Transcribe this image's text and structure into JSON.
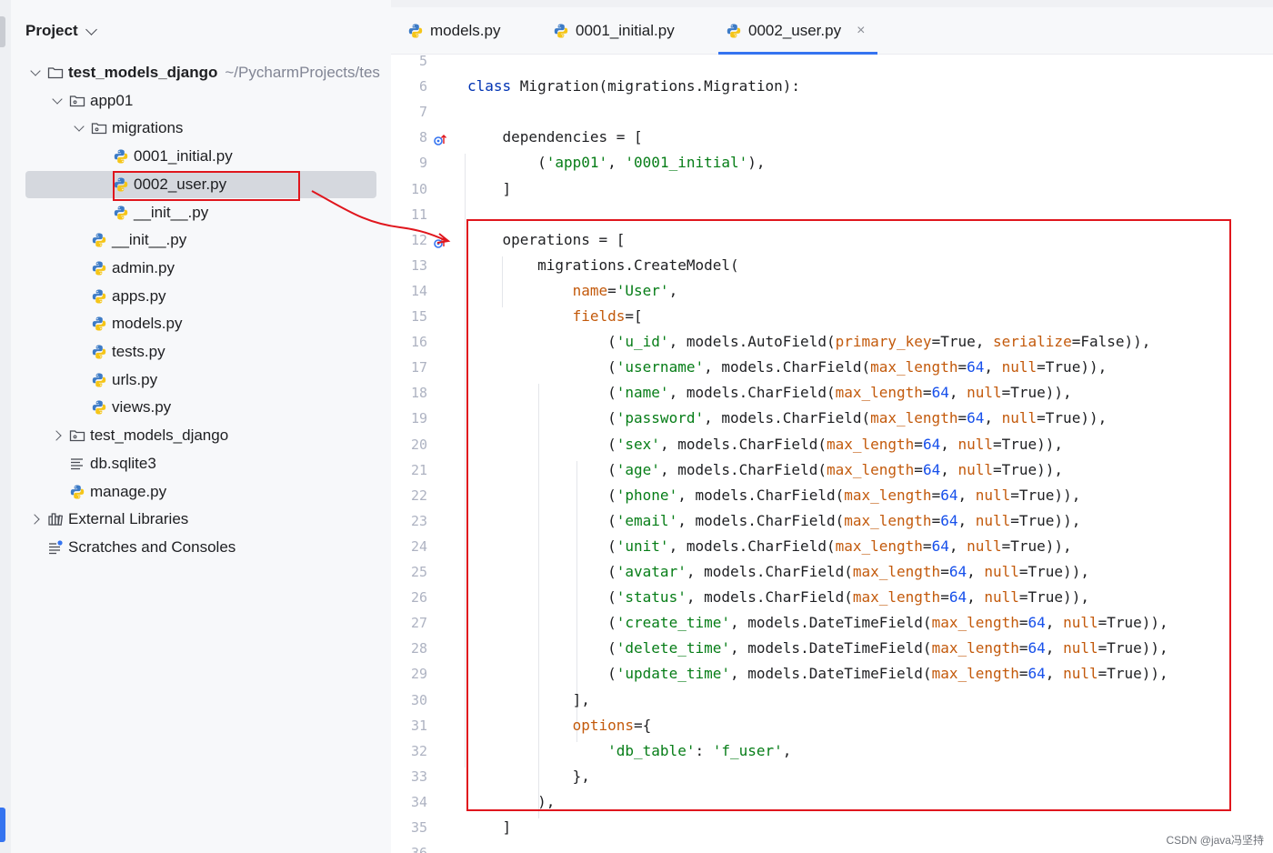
{
  "project_panel": {
    "title": "Project",
    "tree": [
      {
        "label": "test_models_django",
        "secondary": "~/PycharmProjects/tes",
        "icon": "folder-icon",
        "arrow": "down",
        "depth": 0,
        "bold": true
      },
      {
        "label": "app01",
        "icon": "package-folder-icon",
        "arrow": "down",
        "depth": 1
      },
      {
        "label": "migrations",
        "icon": "package-folder-icon",
        "arrow": "down",
        "depth": 2
      },
      {
        "label": "0001_initial.py",
        "icon": "python-file-icon",
        "arrow": "none",
        "depth": 3
      },
      {
        "label": "0002_user.py",
        "icon": "python-file-icon",
        "arrow": "none",
        "depth": 3,
        "selected": true
      },
      {
        "label": "__init__.py",
        "icon": "python-file-icon",
        "arrow": "none",
        "depth": 3
      },
      {
        "label": "__init__.py",
        "icon": "python-file-icon",
        "arrow": "none",
        "depth": 2
      },
      {
        "label": "admin.py",
        "icon": "python-file-icon",
        "arrow": "none",
        "depth": 2
      },
      {
        "label": "apps.py",
        "icon": "python-file-icon",
        "arrow": "none",
        "depth": 2
      },
      {
        "label": "models.py",
        "icon": "python-file-icon",
        "arrow": "none",
        "depth": 2
      },
      {
        "label": "tests.py",
        "icon": "python-file-icon",
        "arrow": "none",
        "depth": 2
      },
      {
        "label": "urls.py",
        "icon": "python-file-icon",
        "arrow": "none",
        "depth": 2
      },
      {
        "label": "views.py",
        "icon": "python-file-icon",
        "arrow": "none",
        "depth": 2
      },
      {
        "label": "test_models_django",
        "icon": "package-folder-icon",
        "arrow": "right",
        "depth": 1
      },
      {
        "label": "db.sqlite3",
        "icon": "text-file-icon",
        "arrow": "none",
        "depth": 1
      },
      {
        "label": "manage.py",
        "icon": "python-file-icon",
        "arrow": "none",
        "depth": 1
      },
      {
        "label": "External Libraries",
        "icon": "library-icon",
        "arrow": "right",
        "depth": 0
      },
      {
        "label": "Scratches and Consoles",
        "icon": "scratches-icon",
        "arrow": "none",
        "depth": 0
      }
    ]
  },
  "editor": {
    "tabs": [
      {
        "label": "models.py",
        "active": false
      },
      {
        "label": "0001_initial.py",
        "active": false
      },
      {
        "label": "0002_user.py",
        "active": true,
        "close": "×"
      }
    ],
    "lines": [
      {
        "n": "5",
        "tokens": []
      },
      {
        "n": "6",
        "tokens": [
          [
            "kw",
            "class "
          ],
          [
            "t",
            "Migration(migrations.Migration):"
          ]
        ]
      },
      {
        "n": "7",
        "tokens": []
      },
      {
        "n": "8",
        "gutter_icon": true,
        "tokens": [
          [
            "t",
            "    dependencies = ["
          ]
        ]
      },
      {
        "n": "9",
        "tokens": [
          [
            "t",
            "        ("
          ],
          [
            "str",
            "'app01'"
          ],
          [
            "t",
            ", "
          ],
          [
            "str",
            "'0001_initial'"
          ],
          [
            "t",
            "),"
          ]
        ]
      },
      {
        "n": "10",
        "tokens": [
          [
            "t",
            "    ]"
          ]
        ]
      },
      {
        "n": "11",
        "tokens": []
      },
      {
        "n": "12",
        "gutter_icon": true,
        "tokens": [
          [
            "t",
            "    operations = ["
          ]
        ]
      },
      {
        "n": "13",
        "tokens": [
          [
            "t",
            "        migrations.CreateModel("
          ]
        ]
      },
      {
        "n": "14",
        "tokens": [
          [
            "t",
            "            "
          ],
          [
            "or",
            "name"
          ],
          [
            "t",
            "="
          ],
          [
            "str",
            "'User'"
          ],
          [
            "t",
            ","
          ]
        ]
      },
      {
        "n": "15",
        "tokens": [
          [
            "t",
            "            "
          ],
          [
            "or",
            "fields"
          ],
          [
            "t",
            "=["
          ]
        ]
      },
      {
        "n": "16",
        "tokens": [
          [
            "t",
            "                ("
          ],
          [
            "str",
            "'u_id'"
          ],
          [
            "t",
            ", models.AutoField("
          ],
          [
            "or",
            "primary_key"
          ],
          [
            "t",
            "=True, "
          ],
          [
            "or",
            "serialize"
          ],
          [
            "t",
            "=False)),"
          ]
        ]
      },
      {
        "n": "17",
        "tokens": [
          [
            "t",
            "                ("
          ],
          [
            "str",
            "'username'"
          ],
          [
            "t",
            ", models.CharField("
          ],
          [
            "or",
            "max_length"
          ],
          [
            "t",
            "="
          ],
          [
            "num",
            "64"
          ],
          [
            "t",
            ", "
          ],
          [
            "or",
            "null"
          ],
          [
            "t",
            "=True)),"
          ]
        ]
      },
      {
        "n": "18",
        "tokens": [
          [
            "t",
            "                ("
          ],
          [
            "str",
            "'name'"
          ],
          [
            "t",
            ", models.CharField("
          ],
          [
            "or",
            "max_length"
          ],
          [
            "t",
            "="
          ],
          [
            "num",
            "64"
          ],
          [
            "t",
            ", "
          ],
          [
            "or",
            "null"
          ],
          [
            "t",
            "=True)),"
          ]
        ]
      },
      {
        "n": "19",
        "tokens": [
          [
            "t",
            "                ("
          ],
          [
            "str",
            "'password'"
          ],
          [
            "t",
            ", models.CharField("
          ],
          [
            "or",
            "max_length"
          ],
          [
            "t",
            "="
          ],
          [
            "num",
            "64"
          ],
          [
            "t",
            ", "
          ],
          [
            "or",
            "null"
          ],
          [
            "t",
            "=True)),"
          ]
        ]
      },
      {
        "n": "20",
        "tokens": [
          [
            "t",
            "                ("
          ],
          [
            "str",
            "'sex'"
          ],
          [
            "t",
            ", models.CharField("
          ],
          [
            "or",
            "max_length"
          ],
          [
            "t",
            "="
          ],
          [
            "num",
            "64"
          ],
          [
            "t",
            ", "
          ],
          [
            "or",
            "null"
          ],
          [
            "t",
            "=True)),"
          ]
        ]
      },
      {
        "n": "21",
        "tokens": [
          [
            "t",
            "                ("
          ],
          [
            "str",
            "'age'"
          ],
          [
            "t",
            ", models.CharField("
          ],
          [
            "or",
            "max_length"
          ],
          [
            "t",
            "="
          ],
          [
            "num",
            "64"
          ],
          [
            "t",
            ", "
          ],
          [
            "or",
            "null"
          ],
          [
            "t",
            "=True)),"
          ]
        ]
      },
      {
        "n": "22",
        "tokens": [
          [
            "t",
            "                ("
          ],
          [
            "str",
            "'phone'"
          ],
          [
            "t",
            ", models.CharField("
          ],
          [
            "or",
            "max_length"
          ],
          [
            "t",
            "="
          ],
          [
            "num",
            "64"
          ],
          [
            "t",
            ", "
          ],
          [
            "or",
            "null"
          ],
          [
            "t",
            "=True)),"
          ]
        ]
      },
      {
        "n": "23",
        "tokens": [
          [
            "t",
            "                ("
          ],
          [
            "str",
            "'email'"
          ],
          [
            "t",
            ", models.CharField("
          ],
          [
            "or",
            "max_length"
          ],
          [
            "t",
            "="
          ],
          [
            "num",
            "64"
          ],
          [
            "t",
            ", "
          ],
          [
            "or",
            "null"
          ],
          [
            "t",
            "=True)),"
          ]
        ]
      },
      {
        "n": "24",
        "tokens": [
          [
            "t",
            "                ("
          ],
          [
            "str",
            "'unit'"
          ],
          [
            "t",
            ", models.CharField("
          ],
          [
            "or",
            "max_length"
          ],
          [
            "t",
            "="
          ],
          [
            "num",
            "64"
          ],
          [
            "t",
            ", "
          ],
          [
            "or",
            "null"
          ],
          [
            "t",
            "=True)),"
          ]
        ]
      },
      {
        "n": "25",
        "tokens": [
          [
            "t",
            "                ("
          ],
          [
            "str",
            "'avatar'"
          ],
          [
            "t",
            ", models.CharField("
          ],
          [
            "or",
            "max_length"
          ],
          [
            "t",
            "="
          ],
          [
            "num",
            "64"
          ],
          [
            "t",
            ", "
          ],
          [
            "or",
            "null"
          ],
          [
            "t",
            "=True)),"
          ]
        ]
      },
      {
        "n": "26",
        "tokens": [
          [
            "t",
            "                ("
          ],
          [
            "str",
            "'status'"
          ],
          [
            "t",
            ", models.CharField("
          ],
          [
            "or",
            "max_length"
          ],
          [
            "t",
            "="
          ],
          [
            "num",
            "64"
          ],
          [
            "t",
            ", "
          ],
          [
            "or",
            "null"
          ],
          [
            "t",
            "=True)),"
          ]
        ]
      },
      {
        "n": "27",
        "tokens": [
          [
            "t",
            "                ("
          ],
          [
            "str",
            "'create_time'"
          ],
          [
            "t",
            ", models.DateTimeField("
          ],
          [
            "or",
            "max_length"
          ],
          [
            "t",
            "="
          ],
          [
            "num",
            "64"
          ],
          [
            "t",
            ", "
          ],
          [
            "or",
            "null"
          ],
          [
            "t",
            "=True)),"
          ]
        ]
      },
      {
        "n": "28",
        "tokens": [
          [
            "t",
            "                ("
          ],
          [
            "str",
            "'delete_time'"
          ],
          [
            "t",
            ", models.DateTimeField("
          ],
          [
            "or",
            "max_length"
          ],
          [
            "t",
            "="
          ],
          [
            "num",
            "64"
          ],
          [
            "t",
            ", "
          ],
          [
            "or",
            "null"
          ],
          [
            "t",
            "=True)),"
          ]
        ]
      },
      {
        "n": "29",
        "tokens": [
          [
            "t",
            "                ("
          ],
          [
            "str",
            "'update_time'"
          ],
          [
            "t",
            ", models.DateTimeField("
          ],
          [
            "or",
            "max_length"
          ],
          [
            "t",
            "="
          ],
          [
            "num",
            "64"
          ],
          [
            "t",
            ", "
          ],
          [
            "or",
            "null"
          ],
          [
            "t",
            "=True)),"
          ]
        ]
      },
      {
        "n": "30",
        "tokens": [
          [
            "t",
            "            ],"
          ]
        ]
      },
      {
        "n": "31",
        "tokens": [
          [
            "t",
            "            "
          ],
          [
            "or",
            "options"
          ],
          [
            "t",
            "={"
          ]
        ]
      },
      {
        "n": "32",
        "tokens": [
          [
            "t",
            "                "
          ],
          [
            "str",
            "'db_table'"
          ],
          [
            "t",
            ": "
          ],
          [
            "str",
            "'f_user'"
          ],
          [
            "t",
            ","
          ]
        ]
      },
      {
        "n": "33",
        "tokens": [
          [
            "t",
            "            },"
          ]
        ]
      },
      {
        "n": "34",
        "tokens": [
          [
            "t",
            "        ),"
          ]
        ]
      },
      {
        "n": "35",
        "tokens": [
          [
            "t",
            "    ]"
          ]
        ]
      },
      {
        "n": "36",
        "tokens": []
      }
    ]
  },
  "watermark": "CSDN @java冯坚持",
  "colors": {
    "highlight_red": "#e0161d",
    "accent_blue": "#3574f0",
    "string_green": "#067d17",
    "param_orange": "#c35a0c",
    "number_blue": "#1750eb",
    "keyword_blue": "#0033b3"
  }
}
